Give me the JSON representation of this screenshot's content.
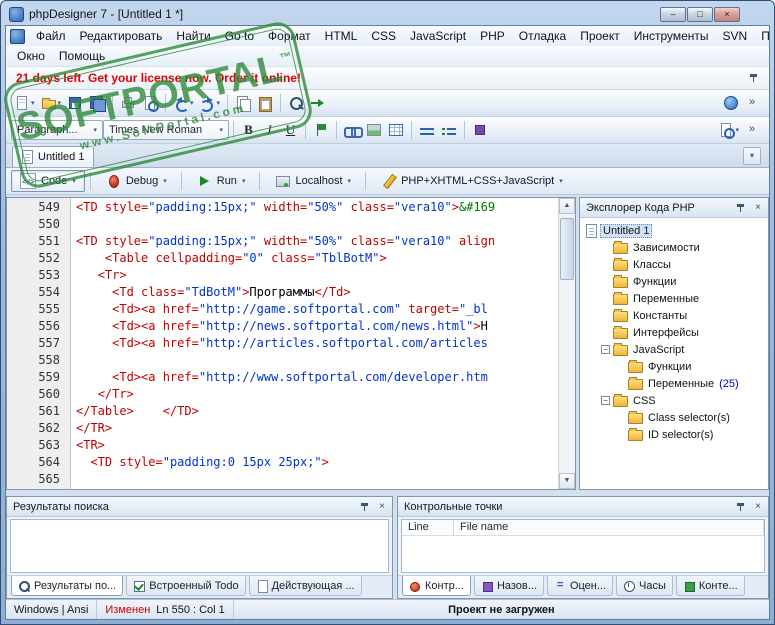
{
  "window": {
    "title": "phpDesigner 7 - [Untitled 1 *]",
    "controls": {
      "minimize": "–",
      "maximize": "□",
      "close": "×"
    }
  },
  "menu": {
    "row1": [
      "Файл",
      "Редактировать",
      "Найти",
      "Go to",
      "Формат",
      "HTML",
      "CSS",
      "JavaScript",
      "PHP",
      "Отладка",
      "Проект",
      "Инструменты",
      "SVN",
      "Просмотр"
    ],
    "row2": [
      "Окно",
      "Помощь"
    ]
  },
  "trial_message": "21 days left. Get your license now. Order it online!",
  "watermark": {
    "name": "SOFTPORTAL",
    "tm": "™",
    "url": "www.SoftPortal.com"
  },
  "toolbar_main": [
    {
      "icon": "new-file",
      "dd": true
    },
    {
      "icon": "open-folder",
      "dd": true
    },
    {
      "icon": "save"
    },
    {
      "icon": "save-all"
    },
    {
      "sep": true
    },
    {
      "icon": "print"
    },
    {
      "icon": "preview"
    },
    {
      "sep": true
    },
    {
      "icon": "undo",
      "dd": true
    },
    {
      "icon": "redo",
      "dd": true
    },
    {
      "sep": true
    },
    {
      "icon": "copy"
    },
    {
      "icon": "paste"
    },
    {
      "sep": true
    },
    {
      "icon": "search"
    },
    {
      "icon": "goto"
    }
  ],
  "toolbar_main_right": [
    {
      "icon": "globe"
    },
    {
      "icon": "overflow"
    }
  ],
  "format_bar": {
    "paragraph": "Paragraph...",
    "font": "Times New Roman",
    "bold": "B",
    "italic": "I",
    "underline": "U"
  },
  "format_icons": [
    {
      "icon": "anchor"
    },
    {
      "sep": true
    },
    {
      "icon": "link"
    },
    {
      "icon": "image"
    },
    {
      "icon": "table"
    },
    {
      "sep": true
    },
    {
      "icon": "list-ul"
    },
    {
      "icon": "list-ol"
    },
    {
      "sep": true
    },
    {
      "icon": "css-box"
    }
  ],
  "format_right": [
    {
      "icon": "preview",
      "dd": true
    },
    {
      "icon": "overflow"
    }
  ],
  "doc_tab": "Untitled 1",
  "code_toolbar": {
    "buttons": [
      {
        "icon": "code",
        "label": "Code",
        "selected": true
      },
      {
        "icon": "debug",
        "label": "Debug"
      },
      {
        "icon": "run",
        "label": "Run"
      },
      {
        "icon": "localhost",
        "label": "Localhost"
      },
      {
        "icon": "pencil",
        "label": "PHP+XHTML+CSS+JavaScript"
      }
    ]
  },
  "editor": {
    "lines": [
      {
        "n": "549",
        "toks": [
          [
            "tag",
            "<TD"
          ],
          [
            "attr",
            " style="
          ],
          [
            "str",
            "\"padding:15px;\""
          ],
          [
            "attr",
            " width="
          ],
          [
            "str",
            "\"50%\""
          ],
          [
            "attr",
            " class="
          ],
          [
            "str",
            "\"vera10\""
          ],
          [
            "tag",
            ">"
          ],
          [
            "ent",
            "&#169"
          ]
        ]
      },
      {
        "n": "550",
        "toks": []
      },
      {
        "n": "551",
        "toks": [
          [
            "tag",
            "<TD"
          ],
          [
            "attr",
            " style="
          ],
          [
            "str",
            "\"padding:15px;\""
          ],
          [
            "attr",
            " width="
          ],
          [
            "str",
            "\"50%\""
          ],
          [
            "attr",
            " class="
          ],
          [
            "str",
            "\"vera10\""
          ],
          [
            "attr",
            " align"
          ]
        ]
      },
      {
        "n": "552",
        "toks": [
          [
            "p",
            "    "
          ],
          [
            "tag",
            "<Table"
          ],
          [
            "attr",
            " cellpadding="
          ],
          [
            "str",
            "\"0\""
          ],
          [
            "attr",
            " class="
          ],
          [
            "str",
            "\"TblBotM\""
          ],
          [
            "tag",
            ">"
          ]
        ]
      },
      {
        "n": "553",
        "toks": [
          [
            "p",
            "   "
          ],
          [
            "tag",
            "<Tr>"
          ]
        ]
      },
      {
        "n": "554",
        "toks": [
          [
            "p",
            "     "
          ],
          [
            "tag",
            "<Td"
          ],
          [
            "attr",
            " class="
          ],
          [
            "str",
            "\"TdBotM\""
          ],
          [
            "tag",
            ">"
          ],
          [
            "txt",
            "Программы"
          ],
          [
            "tag",
            "</Td>"
          ]
        ]
      },
      {
        "n": "555",
        "toks": [
          [
            "p",
            "     "
          ],
          [
            "tag",
            "<Td><a"
          ],
          [
            "attr",
            " href="
          ],
          [
            "str",
            "\"http://game.softportal.com\""
          ],
          [
            "attr",
            " target="
          ],
          [
            "str",
            "\"_bl"
          ]
        ]
      },
      {
        "n": "556",
        "toks": [
          [
            "p",
            "     "
          ],
          [
            "tag",
            "<Td><a"
          ],
          [
            "attr",
            " href="
          ],
          [
            "str",
            "\"http://news.softportal.com/news.html\""
          ],
          [
            "tag",
            ">"
          ],
          [
            "txt",
            "Н"
          ]
        ]
      },
      {
        "n": "557",
        "toks": [
          [
            "p",
            "     "
          ],
          [
            "tag",
            "<Td><a"
          ],
          [
            "attr",
            " href="
          ],
          [
            "str",
            "\"http://articles.softportal.com/articles"
          ]
        ]
      },
      {
        "n": "558",
        "toks": []
      },
      {
        "n": "559",
        "toks": [
          [
            "p",
            "     "
          ],
          [
            "tag",
            "<Td><a"
          ],
          [
            "attr",
            " href="
          ],
          [
            "str",
            "\"http://www.softportal.com/developer.htm"
          ]
        ]
      },
      {
        "n": "560",
        "toks": [
          [
            "p",
            "   "
          ],
          [
            "tag",
            "</Tr>"
          ]
        ]
      },
      {
        "n": "561",
        "toks": [
          [
            "tag",
            "</Table>"
          ],
          [
            "p",
            "    "
          ],
          [
            "tag",
            "</TD>"
          ]
        ]
      },
      {
        "n": "562",
        "toks": [
          [
            "tag",
            "</TR>"
          ]
        ]
      },
      {
        "n": "563",
        "toks": [
          [
            "tag",
            "<TR>"
          ]
        ]
      },
      {
        "n": "564",
        "toks": [
          [
            "p",
            "  "
          ],
          [
            "tag",
            "<TD"
          ],
          [
            "attr",
            " style="
          ],
          [
            "str",
            "\"padding:0 15px 25px;\""
          ],
          [
            "tag",
            ">"
          ]
        ]
      },
      {
        "n": "565",
        "toks": []
      }
    ]
  },
  "explorer": {
    "title": "Эксплорер Кода PHP",
    "tree": [
      {
        "label": "Untitled 1",
        "level": 0,
        "icon": "doc",
        "selected": true
      },
      {
        "label": "Зависимости",
        "level": 1,
        "icon": "folder"
      },
      {
        "label": "Классы",
        "level": 1,
        "icon": "folder"
      },
      {
        "label": "Функции",
        "level": 1,
        "icon": "folder"
      },
      {
        "label": "Переменные",
        "level": 1,
        "icon": "folder"
      },
      {
        "label": "Константы",
        "level": 1,
        "icon": "folder"
      },
      {
        "label": "Интерфейсы",
        "level": 1,
        "icon": "folder"
      },
      {
        "label": "JavaScript",
        "level": 1,
        "icon": "folder",
        "expander": "minus"
      },
      {
        "label": "Функции",
        "level": 2,
        "icon": "folder"
      },
      {
        "label": "Переменные",
        "count": "(25)",
        "level": 2,
        "icon": "folder"
      },
      {
        "label": "CSS",
        "level": 1,
        "icon": "folder",
        "expander": "minus"
      },
      {
        "label": "Class selector(s)",
        "level": 2,
        "icon": "folder"
      },
      {
        "label": "ID selector(s)",
        "level": 2,
        "icon": "folder"
      }
    ]
  },
  "bottom": {
    "search_panel": {
      "title": "Результаты поиска",
      "tabs": [
        {
          "label": "Результаты по...",
          "icon": "search-results",
          "selected": true
        },
        {
          "label": "Встроенный Todo",
          "icon": "todo"
        },
        {
          "label": "Действующая ...",
          "icon": "active-file"
        }
      ]
    },
    "breakpoints_panel": {
      "title": "Контрольные точки",
      "columns": [
        "Line",
        "File name"
      ],
      "tabs": [
        {
          "label": "Контр...",
          "icon": "breakpoints",
          "selected": true
        },
        {
          "label": "Назов...",
          "icon": "names"
        },
        {
          "label": "Оцен...",
          "icon": "evaluate"
        },
        {
          "label": "Часы",
          "icon": "watches"
        },
        {
          "label": "Конте...",
          "icon": "context"
        }
      ]
    }
  },
  "statusbar": {
    "encoding": "Windows | Ansi",
    "modified": "Изменен",
    "position": "Ln  550 : Col  1",
    "project": "Проект не загружен"
  }
}
